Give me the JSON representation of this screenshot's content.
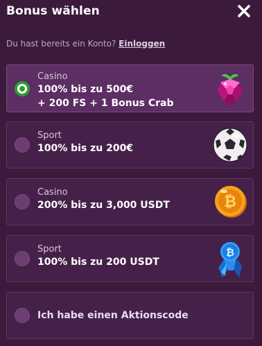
{
  "header": {
    "title": "Bonus wählen",
    "subtitle_text": "Du hast bereits ein Konto?",
    "login_link": "Einloggen"
  },
  "options": [
    {
      "category": "Casino",
      "line1": "100% bis zu 500€",
      "line2": "+ 200 FS + 1 Bonus Crab",
      "icon": "raspberry-gem-icon",
      "selected": true
    },
    {
      "category": "Sport",
      "line1": "100% bis zu 200€",
      "icon": "soccer-ball-icon",
      "selected": false
    },
    {
      "category": "Casino",
      "line1": "200% bis zu 3,000 USDT",
      "icon": "bitcoin-coin-icon",
      "selected": false
    },
    {
      "category": "Sport",
      "line1": "100% bis zu 200 USDT",
      "icon": "bitcoin-crystal-icon",
      "selected": false
    }
  ],
  "promo": {
    "label": "Ich habe einen Aktionscode",
    "selected": false
  },
  "colors": {
    "background": "#3b1a3c",
    "card": "#45214a",
    "selected_card": "#5c2e63",
    "radio_selected": "#2e9e2e"
  }
}
